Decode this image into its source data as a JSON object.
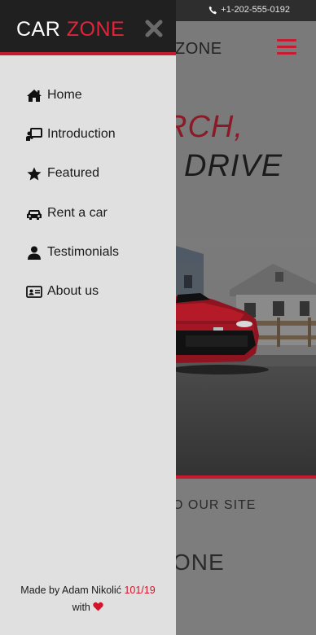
{
  "header": {
    "phone": "+1-202-555-0192"
  },
  "navbar": {
    "brand_partial": "ZONE"
  },
  "hero": {
    "line1": "RCH,",
    "line2": "DRIVE"
  },
  "section": {
    "visit_partial": "O OUR SITE",
    "brand_partial": "ONE"
  },
  "sidebar": {
    "brand_part1": "CAR",
    "brand_part2": "ZONE",
    "items": [
      {
        "label": "Home",
        "icon": "home-icon"
      },
      {
        "label": "Introduction",
        "icon": "presentation-icon"
      },
      {
        "label": "Featured",
        "icon": "star-icon"
      },
      {
        "label": "Rent a car",
        "icon": "car-icon"
      },
      {
        "label": "Testimonials",
        "icon": "user-icon"
      },
      {
        "label": "About us",
        "icon": "id-card-icon"
      }
    ],
    "credit_prefix": "Made by Adam Nikolić",
    "credit_tag": "101/19",
    "credit_with": "with"
  },
  "colors": {
    "accent": "#c41b2f",
    "sidebar_bg": "#e0e0e0",
    "header_bg": "#202020"
  }
}
